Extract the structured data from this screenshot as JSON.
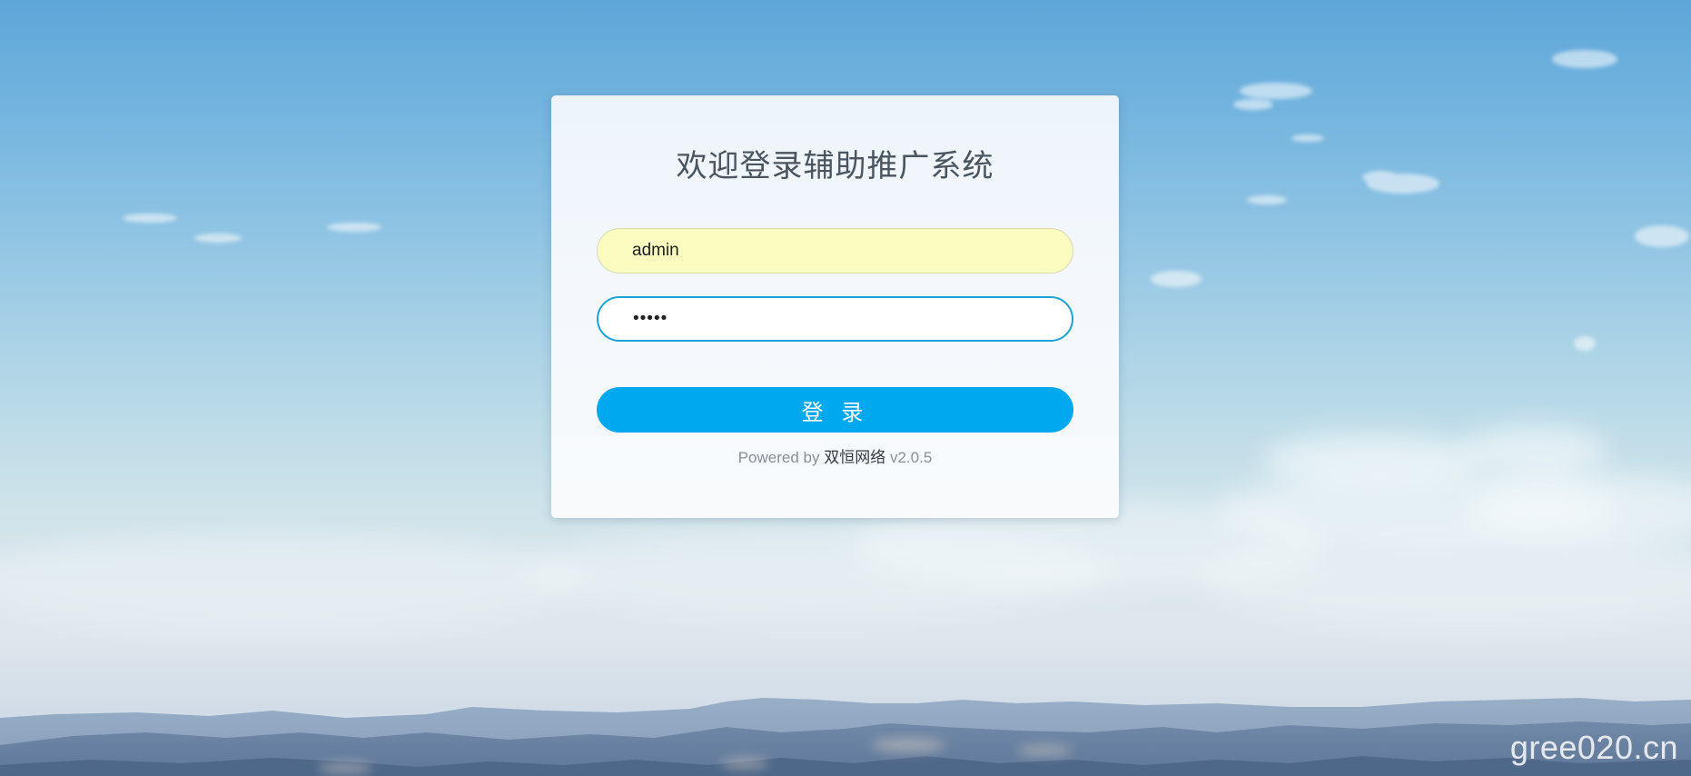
{
  "page": {
    "title": "欢迎登录辅助推广系统"
  },
  "form": {
    "username": {
      "value": "admin"
    },
    "password": {
      "masked_value": "•••••"
    },
    "submit_label": "登 录"
  },
  "footer": {
    "powered_prefix": "Powered by",
    "company": "双恒网络",
    "version": "v2.0.5"
  },
  "watermark": {
    "text": "gree020.cn"
  },
  "colors": {
    "button": "#00a9ef",
    "username_field_bg": "#fafcc0",
    "password_field_border": "#1aa3d6",
    "title_text": "#4a5560"
  }
}
